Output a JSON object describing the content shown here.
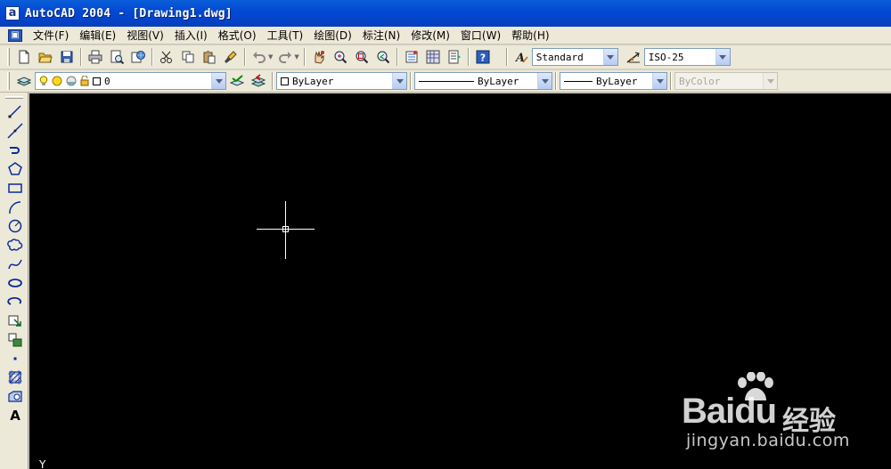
{
  "window": {
    "title": "AutoCAD 2004 - [Drawing1.dwg]",
    "app_icon_glyph": "a"
  },
  "menu": {
    "items": [
      "文件(F)",
      "编辑(E)",
      "视图(V)",
      "插入(I)",
      "格式(O)",
      "工具(T)",
      "绘图(D)",
      "标注(N)",
      "修改(M)",
      "窗口(W)",
      "帮助(H)"
    ]
  },
  "standard_toolbar": {
    "text_style": "Standard",
    "dim_style": "ISO-25"
  },
  "properties_toolbar": {
    "current_layer": "0",
    "color": "ByLayer",
    "linetype": "ByLayer",
    "lineweight": "ByLayer",
    "plot_style": "ByColor"
  },
  "draw_toolbar": {
    "text_tool_glyph": "A"
  },
  "canvas": {
    "background": "#000000",
    "ucs_label": "Y"
  },
  "watermark": {
    "brand_left": "Bai",
    "brand_right": "经验",
    "url": "jingyan.baidu.com"
  }
}
